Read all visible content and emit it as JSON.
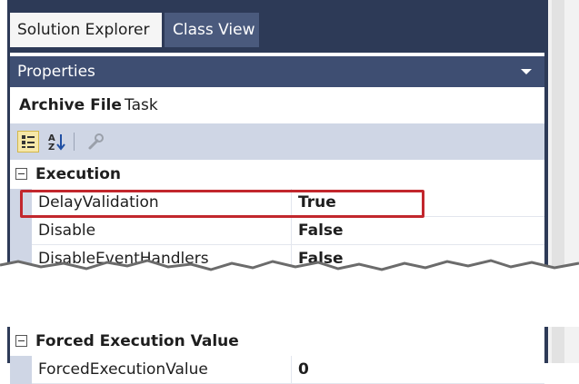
{
  "tabs": [
    {
      "label": "Solution Explorer",
      "active": true
    },
    {
      "label": "Class View",
      "active": false
    }
  ],
  "properties_panel": {
    "title": "Properties",
    "object_name": "Archive File",
    "object_type": "Task"
  },
  "toolbar": {
    "buttons": [
      "categorized-icon",
      "alphabetical-icon",
      "property-pages-icon"
    ]
  },
  "categories": [
    {
      "label": "Execution",
      "properties": [
        {
          "name": "DelayValidation",
          "value": "True"
        },
        {
          "name": "Disable",
          "value": "False"
        },
        {
          "name": "DisableEventHandlers",
          "value": "False"
        }
      ]
    },
    {
      "label": "Forced Execution Value",
      "properties": [
        {
          "name": "ForcedExecutionValue",
          "value": "0"
        }
      ]
    }
  ],
  "colors": {
    "tabstrip": "#2d3a57",
    "titlebar": "#3e4e72",
    "toolbar": "#cfd6e5",
    "highlight": "#c2272d"
  }
}
